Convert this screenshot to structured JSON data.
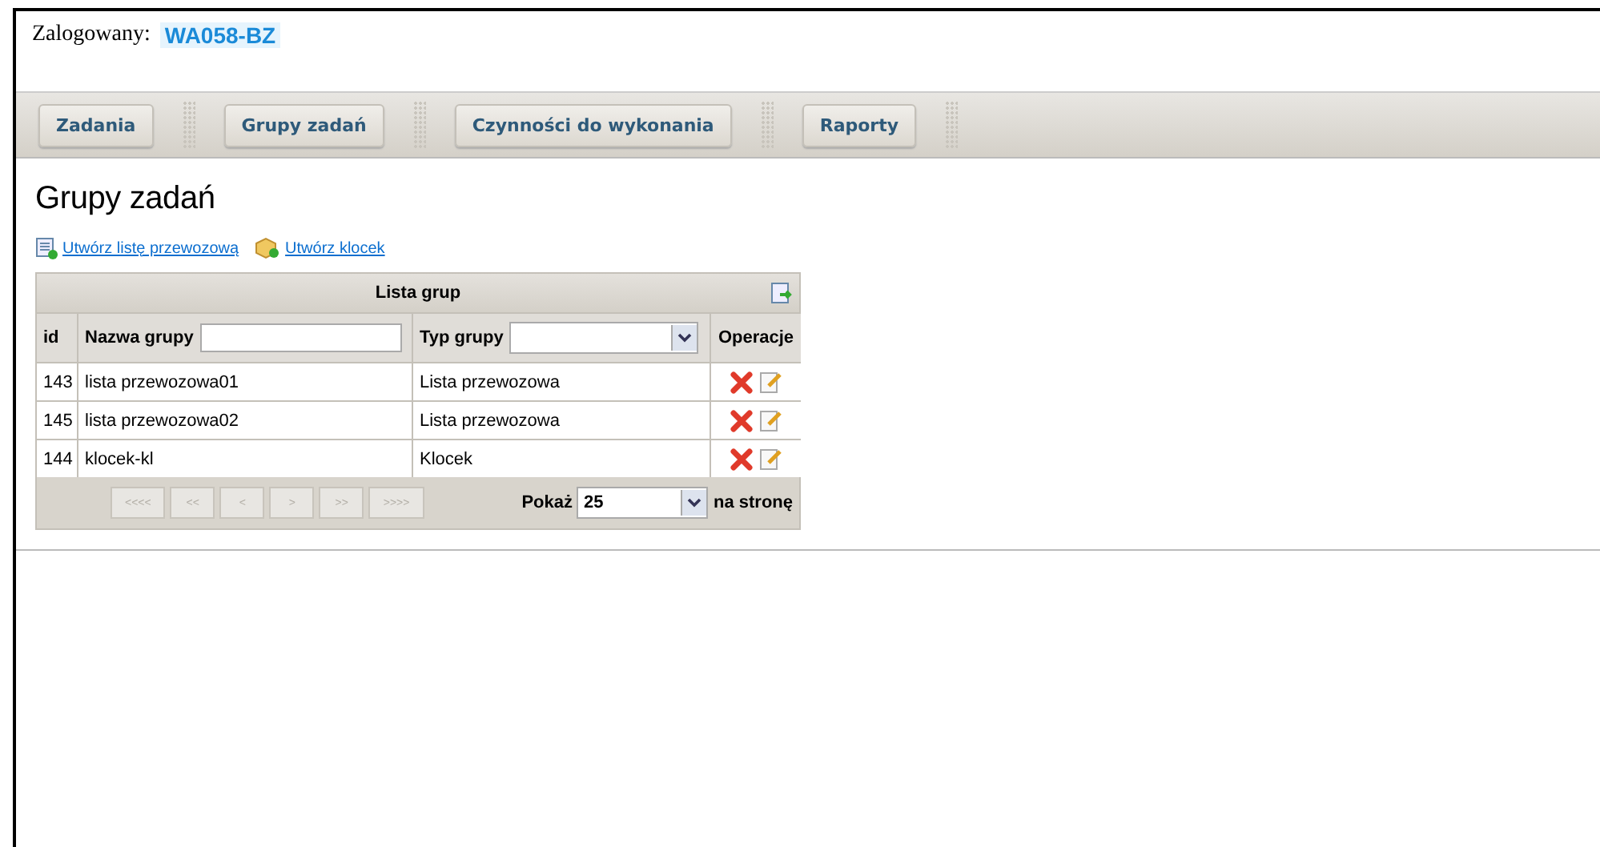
{
  "login": {
    "label": "Zalogowany:",
    "user": "WA058-BZ"
  },
  "nav": [
    {
      "label": "Zadania"
    },
    {
      "label": "Grupy zadań"
    },
    {
      "label": "Czynności do wykonania"
    },
    {
      "label": "Raporty"
    }
  ],
  "heading": "Grupy zadań",
  "actions": [
    {
      "label": "Utwórz listę przewozową",
      "kind": "list"
    },
    {
      "label": "Utwórz klocek",
      "kind": "block"
    }
  ],
  "table": {
    "title": "Lista grup",
    "columns": [
      {
        "label": "id",
        "kind": "plain"
      },
      {
        "label": "Nazwa grupy",
        "kind": "text"
      },
      {
        "label": "Typ grupy",
        "kind": "select"
      },
      {
        "label": "Operacje",
        "kind": "plain"
      }
    ],
    "rows": [
      {
        "id": "143",
        "name": "lista przewozowa01",
        "type": "Lista przewozowa"
      },
      {
        "id": "145",
        "name": "lista przewozowa02",
        "type": "Lista przewozowa"
      },
      {
        "id": "144",
        "name": "klocek-kl",
        "type": "Klocek"
      }
    ],
    "pager": [
      {
        "label": "<<<<",
        "disabled": true
      },
      {
        "label": "<<",
        "disabled": true
      },
      {
        "label": "<",
        "disabled": true
      },
      {
        "label": ">",
        "disabled": true
      },
      {
        "label": ">>",
        "disabled": true
      },
      {
        "label": ">>>>",
        "disabled": true
      }
    ],
    "page_size": {
      "label": "Pokaż",
      "value": "25",
      "suffix": "na stronę"
    }
  }
}
